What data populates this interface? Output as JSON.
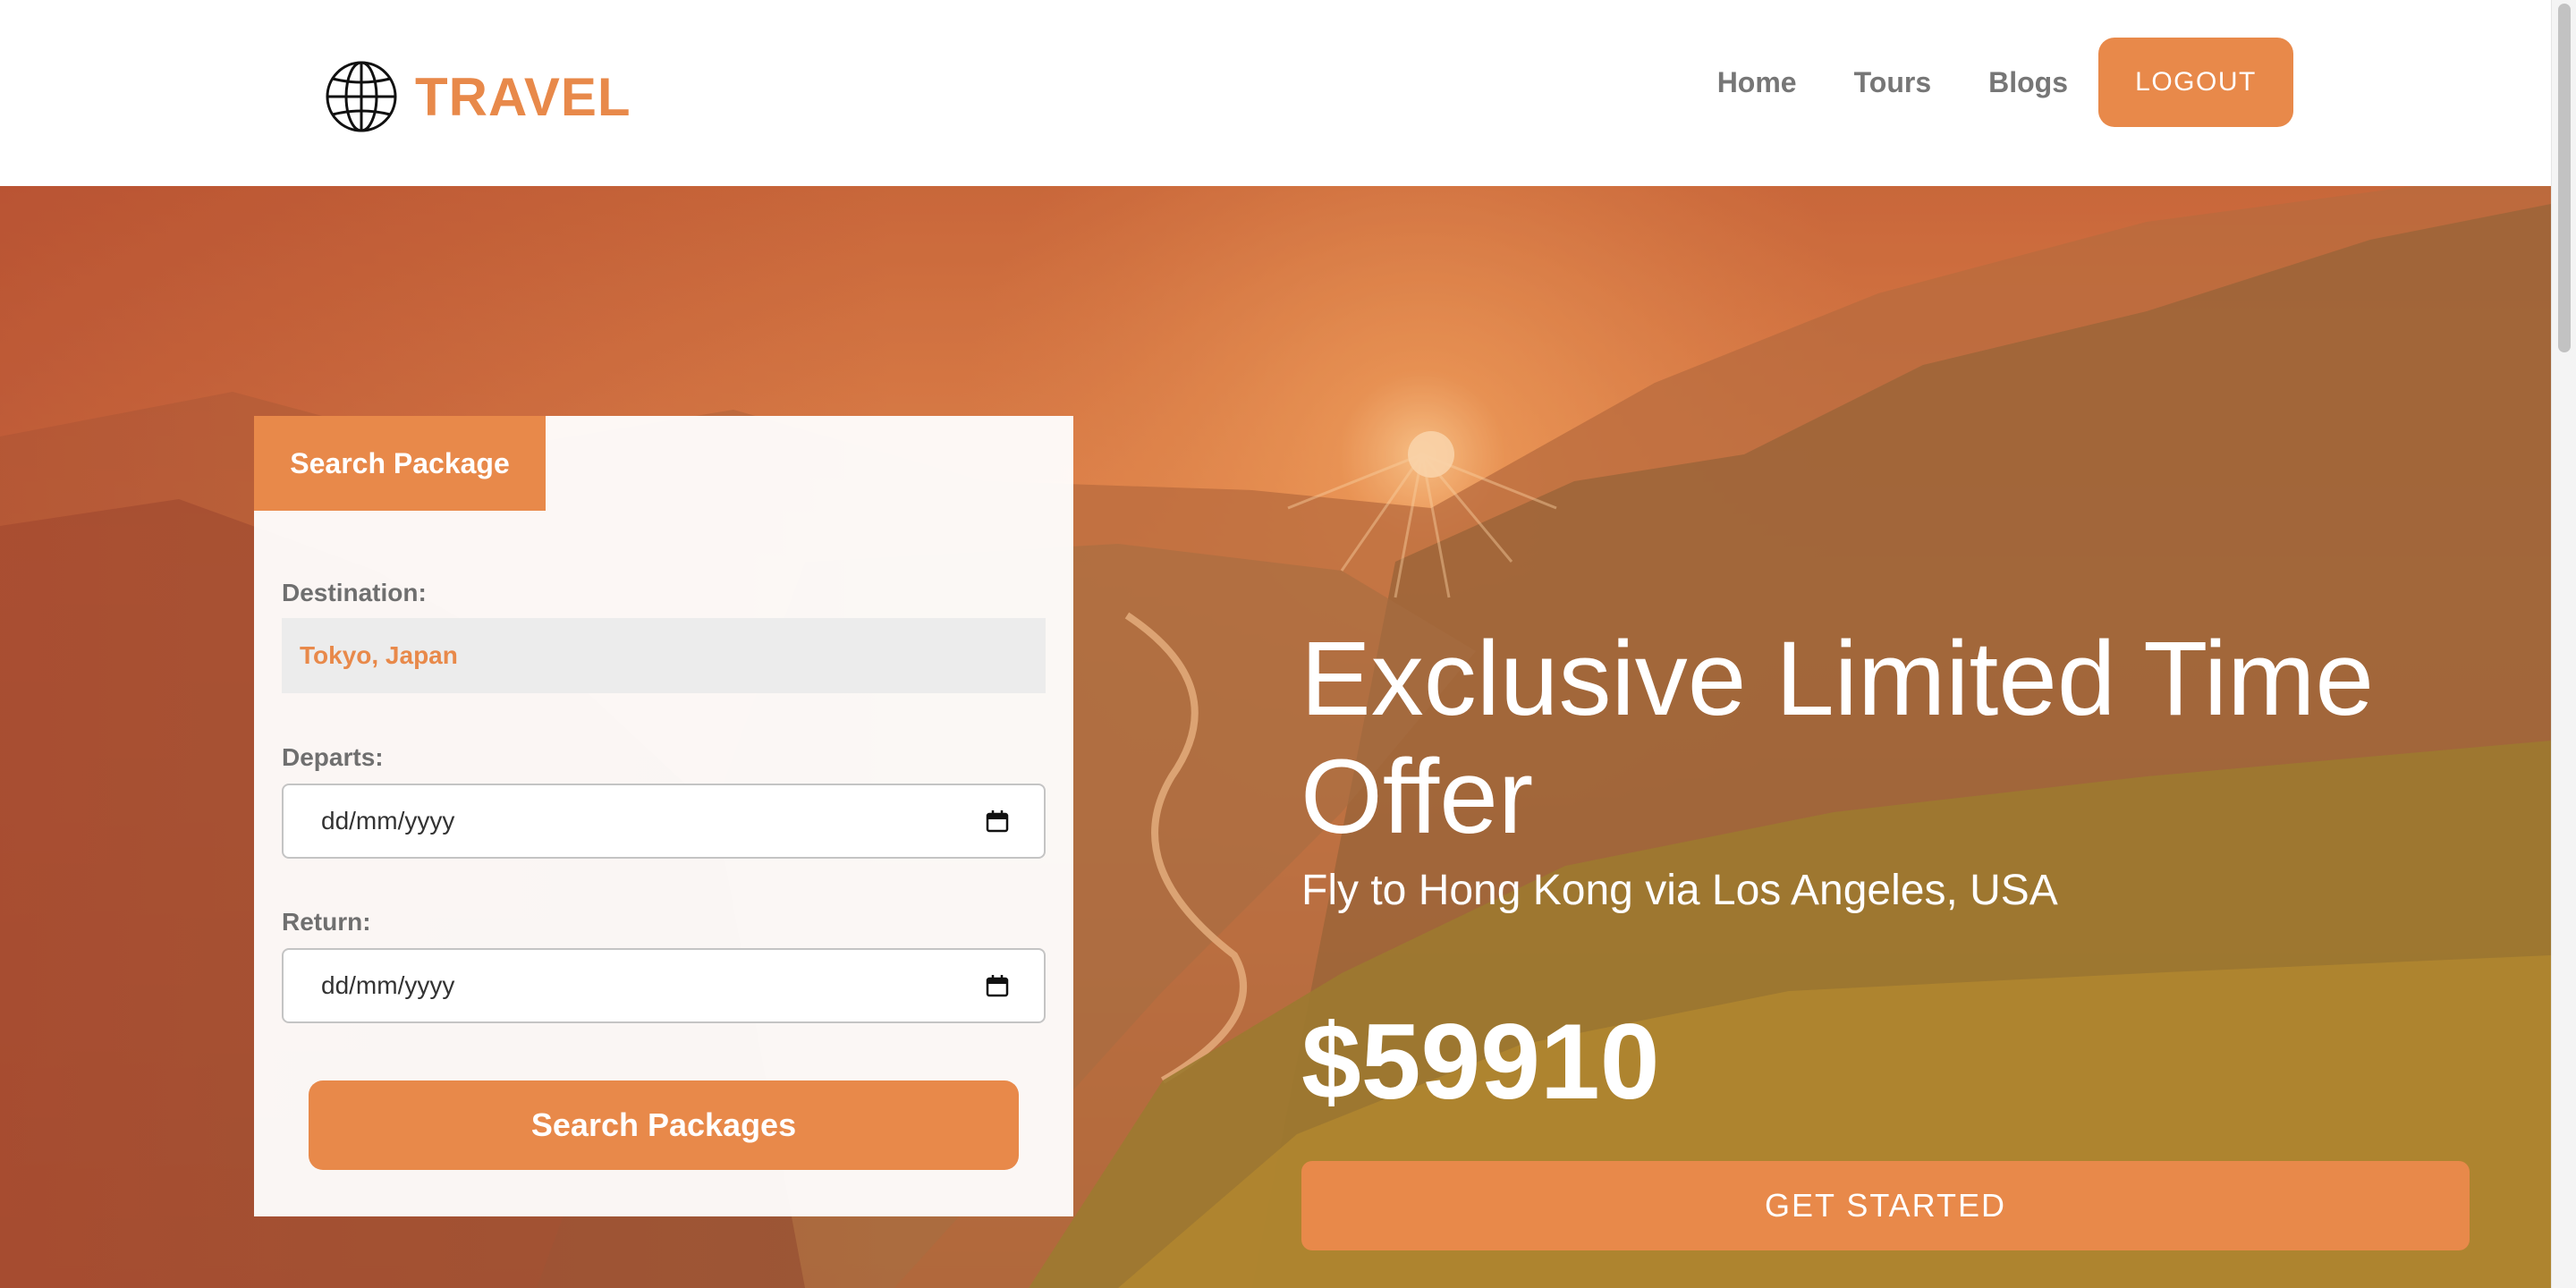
{
  "header": {
    "logo_text": "TRAVEL",
    "nav": [
      {
        "label": "Home"
      },
      {
        "label": "Tours"
      },
      {
        "label": "Blogs"
      }
    ],
    "logout_label": "LOGOUT"
  },
  "search": {
    "tab_label": "Search Package",
    "destination_label": "Destination:",
    "destination_value": "Tokyo, Japan",
    "departs_label": "Departs:",
    "departs_value": "dd/mm/yyyy",
    "return_label": "Return:",
    "return_value": "dd/mm/yyyy",
    "button_label": "Search Packages"
  },
  "offer": {
    "title": "Exclusive Limited Time Offer",
    "subtitle": "Fly to Hong Kong via Los Angeles, USA",
    "price": "$59910",
    "cta_label": "GET STARTED"
  },
  "colors": {
    "accent": "#e8894a",
    "nav_text": "#767676",
    "label_text": "#6f6f6f"
  },
  "icons": {
    "logo": "globe-icon",
    "date": "calendar-icon"
  }
}
